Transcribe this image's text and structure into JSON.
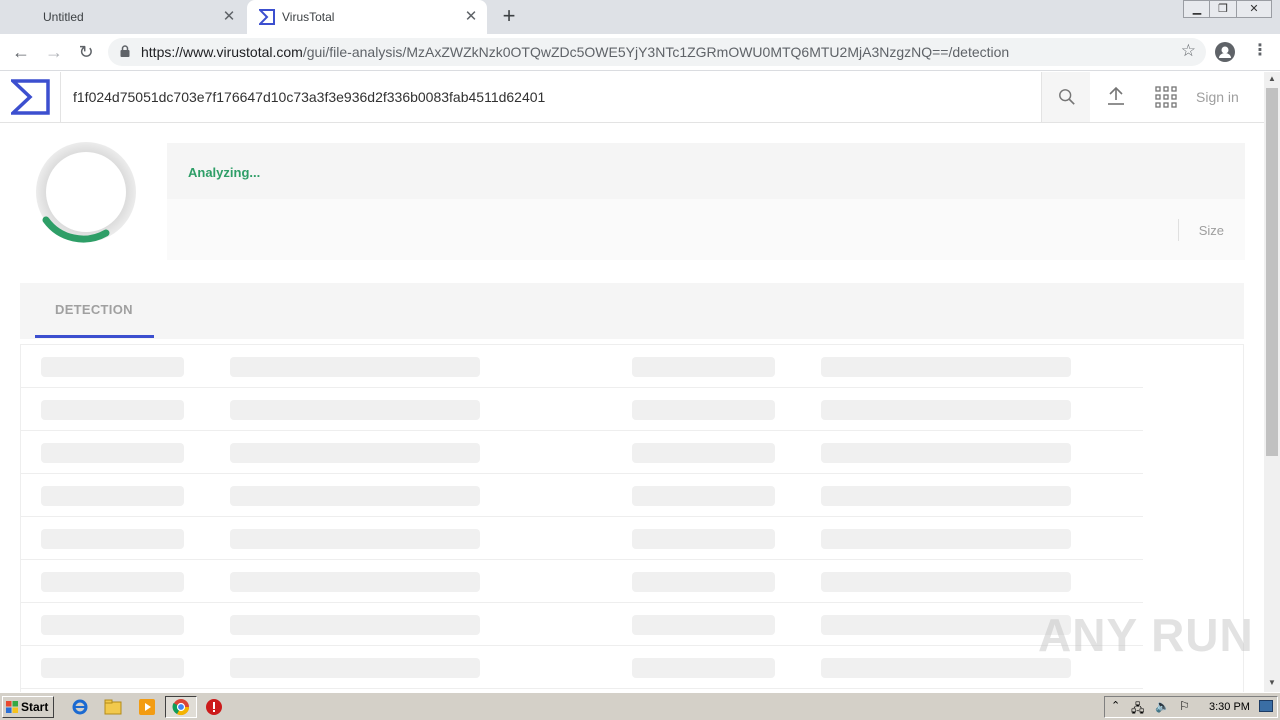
{
  "browser": {
    "tabs": [
      {
        "title": "Untitled",
        "active": false
      },
      {
        "title": "VirusTotal",
        "active": true
      }
    ],
    "close_glyph": "✕",
    "new_tab_glyph": "+",
    "url_host": "https://www.virustotal.com",
    "url_path": "/gui/file-analysis/MzAxZWZkNzk0OTQwZDc5OWE5YjY3NTc1ZGRmOWU0MTQ6MTU2MjA3NzgzNQ==/detection"
  },
  "vt": {
    "search_value": "f1f024d75051dc703e7f176647d10c73a3f3e936d2f336b0083fab4511d62401",
    "sign_in": "Sign in",
    "status": "Analyzing...",
    "size_label": "Size",
    "tab_detection": "DETECTION",
    "accent_color": "#3c4fcf",
    "status_color": "#2e9e67"
  },
  "taskbar": {
    "start_label": "Start",
    "clock": "3:30 PM"
  },
  "watermark": "ANY RUN"
}
